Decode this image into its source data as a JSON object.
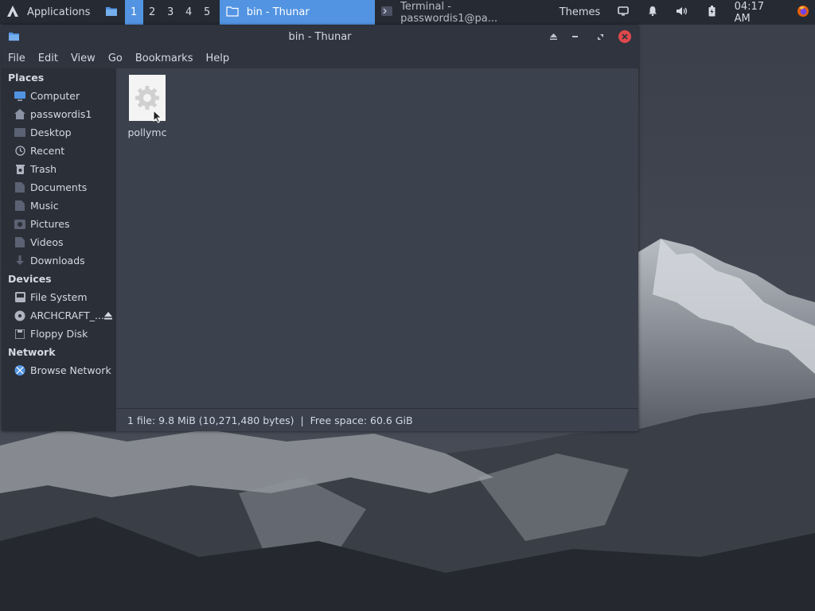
{
  "panel": {
    "apps_label": "Applications",
    "workspaces": [
      "1",
      "2",
      "3",
      "4",
      "5"
    ],
    "active_workspace": 0,
    "tasks": {
      "thunar": "bin - Thunar",
      "terminal": "Terminal - passwordis1@pa..."
    },
    "themes_label": "Themes",
    "clock": "04:17 AM"
  },
  "window": {
    "title": "bin - Thunar",
    "menu": [
      "File",
      "Edit",
      "View",
      "Go",
      "Bookmarks",
      "Help"
    ]
  },
  "sidebar": {
    "places_title": "Places",
    "places": [
      {
        "label": "Computer",
        "icon": "computer-icon"
      },
      {
        "label": "passwordis1",
        "icon": "home-icon"
      },
      {
        "label": "Desktop",
        "icon": "desktop-icon"
      },
      {
        "label": "Recent",
        "icon": "recent-icon"
      },
      {
        "label": "Trash",
        "icon": "trash-icon"
      },
      {
        "label": "Documents",
        "icon": "documents-icon"
      },
      {
        "label": "Music",
        "icon": "music-icon"
      },
      {
        "label": "Pictures",
        "icon": "pictures-icon"
      },
      {
        "label": "Videos",
        "icon": "videos-icon"
      },
      {
        "label": "Downloads",
        "icon": "downloads-icon"
      }
    ],
    "devices_title": "Devices",
    "devices": [
      {
        "label": "File System",
        "icon": "drive-icon"
      },
      {
        "label": "ARCHCRAFT_...",
        "icon": "optical-disc-icon"
      },
      {
        "label": "Floppy Disk",
        "icon": "floppy-icon"
      }
    ],
    "network_title": "Network",
    "network": [
      {
        "label": "Browse Network",
        "icon": "network-icon"
      }
    ]
  },
  "files": [
    {
      "name": "pollymc",
      "icon": "executable-gear-icon"
    }
  ],
  "status": {
    "text": "1 file: 9.8 MiB (10,271,480 bytes)  |  Free space: 60.6 GiB"
  },
  "colors": {
    "accent": "#5294e2",
    "panel_bg": "#262a33",
    "window_bg": "#2f343f",
    "view_bg": "#3b414d",
    "close": "#e0484b"
  }
}
